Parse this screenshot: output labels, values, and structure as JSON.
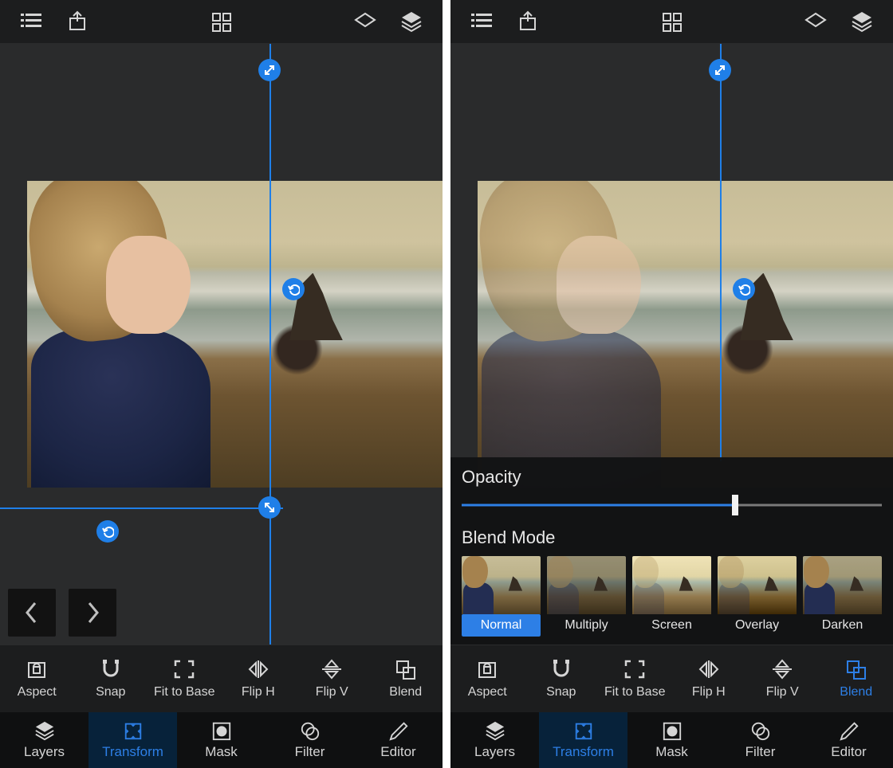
{
  "colors": {
    "accent": "#2d7fe6",
    "icon": "#d5d5d5",
    "bg": "#1c1d1e"
  },
  "topbar": {
    "icons": [
      "list-icon",
      "share-icon",
      "grid-icon",
      "layer-outline-icon",
      "layers-stack-icon"
    ]
  },
  "pager": {
    "prev_icon": "chevron-left-icon",
    "next_icon": "chevron-right-icon"
  },
  "blend_panel": {
    "opacity_label": "Opacity",
    "opacity_percent": 65,
    "mode_label": "Blend Mode",
    "modes": [
      {
        "label": "Normal",
        "active": true
      },
      {
        "label": "Multiply",
        "active": false
      },
      {
        "label": "Screen",
        "active": false
      },
      {
        "label": "Overlay",
        "active": false
      },
      {
        "label": "Darken",
        "active": false
      }
    ]
  },
  "actions": [
    {
      "label": "Aspect",
      "icon": "lock-icon"
    },
    {
      "label": "Snap",
      "icon": "magnet-icon"
    },
    {
      "label": "Fit to Base",
      "icon": "fit-icon"
    },
    {
      "label": "Flip H",
      "icon": "flip-h-icon"
    },
    {
      "label": "Flip V",
      "icon": "flip-v-icon"
    },
    {
      "label": "Blend",
      "icon": "blend-icon"
    }
  ],
  "bottom_nav": [
    {
      "label": "Layers",
      "icon": "layers-icon"
    },
    {
      "label": "Transform",
      "icon": "transform-icon",
      "active": true
    },
    {
      "label": "Mask",
      "icon": "mask-icon"
    },
    {
      "label": "Filter",
      "icon": "filter-icon"
    },
    {
      "label": "Editor",
      "icon": "editor-icon"
    }
  ],
  "right_pane": {
    "blend_action_active": true
  }
}
